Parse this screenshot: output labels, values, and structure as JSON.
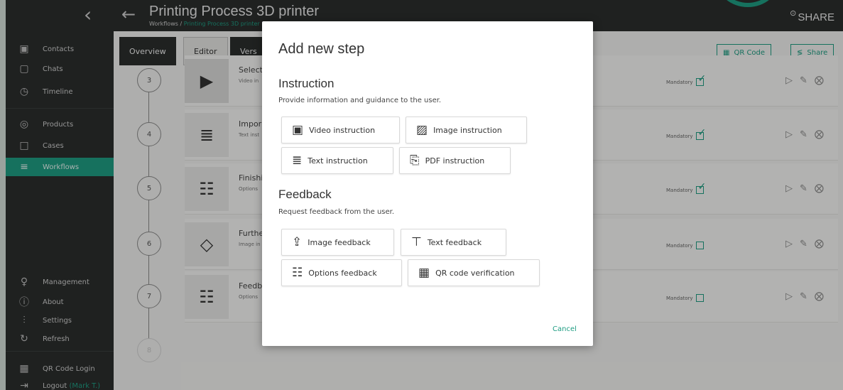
{
  "header": {
    "title": "Printing Process 3D printer",
    "breadcrumb_root": "Workflows /",
    "breadcrumb_current": "Printing Process 3D printer",
    "share_label": "SHARE"
  },
  "sidebar": {
    "items": [
      {
        "label": "Contacts",
        "icon": "contacts-icon",
        "glyph": "▣"
      },
      {
        "label": "Chats",
        "icon": "chat-icon",
        "glyph": "▢"
      },
      {
        "label": "Timeline",
        "icon": "clock-icon",
        "glyph": "◷"
      },
      {
        "label": "Products",
        "icon": "products-icon",
        "glyph": "◎"
      },
      {
        "label": "Cases",
        "icon": "cases-icon",
        "glyph": "□"
      },
      {
        "label": "Workflows",
        "icon": "workflows-icon",
        "glyph": "≡"
      },
      {
        "label": "Management",
        "icon": "bulb-icon",
        "glyph": "♀"
      },
      {
        "label": "About",
        "icon": "info-icon",
        "glyph": "ⓘ"
      },
      {
        "label": "Settings",
        "icon": "sliders-icon",
        "glyph": "⫶"
      },
      {
        "label": "Refresh",
        "icon": "refresh-icon",
        "glyph": "↻"
      },
      {
        "label": "QR Code Login",
        "icon": "qr-icon",
        "glyph": "▦"
      },
      {
        "label": "Logout",
        "icon": "logout-icon",
        "glyph": "⇥"
      }
    ],
    "logout_user": "(Mark T.)"
  },
  "tabs": [
    "Overview",
    "Editor",
    "Vers"
  ],
  "header_buttons": {
    "qr_code": "QR Code",
    "share": "Share"
  },
  "steps": [
    {
      "num": "3",
      "title": "Select",
      "sub": "Video in",
      "mandatory": true
    },
    {
      "num": "4",
      "title": "Impor",
      "sub": "Text inst",
      "mandatory": true
    },
    {
      "num": "5",
      "title": "Finishi",
      "sub": "Options",
      "mandatory": true
    },
    {
      "num": "6",
      "title": "Furthe",
      "sub": "Image in",
      "mandatory": false
    },
    {
      "num": "7",
      "title": "Feedb",
      "sub": "Options",
      "mandatory": false
    },
    {
      "num": "8"
    }
  ],
  "mandatory_label": "Mandatory",
  "modal": {
    "title": "Add new step",
    "instruction_heading": "Instruction",
    "instruction_desc": "Provide information and guidance to the user.",
    "instruction_buttons": [
      "Video instruction",
      "Image instruction",
      "Text instruction",
      "PDF instruction"
    ],
    "feedback_heading": "Feedback",
    "feedback_desc": "Request feedback from the user.",
    "feedback_buttons": [
      "Image feedback",
      "Text feedback",
      "Options feedback",
      "QR code verification"
    ],
    "cancel_label": "Cancel"
  },
  "colors": {
    "accent": "#1f9d83",
    "sidebar": "#2b2e2d"
  }
}
